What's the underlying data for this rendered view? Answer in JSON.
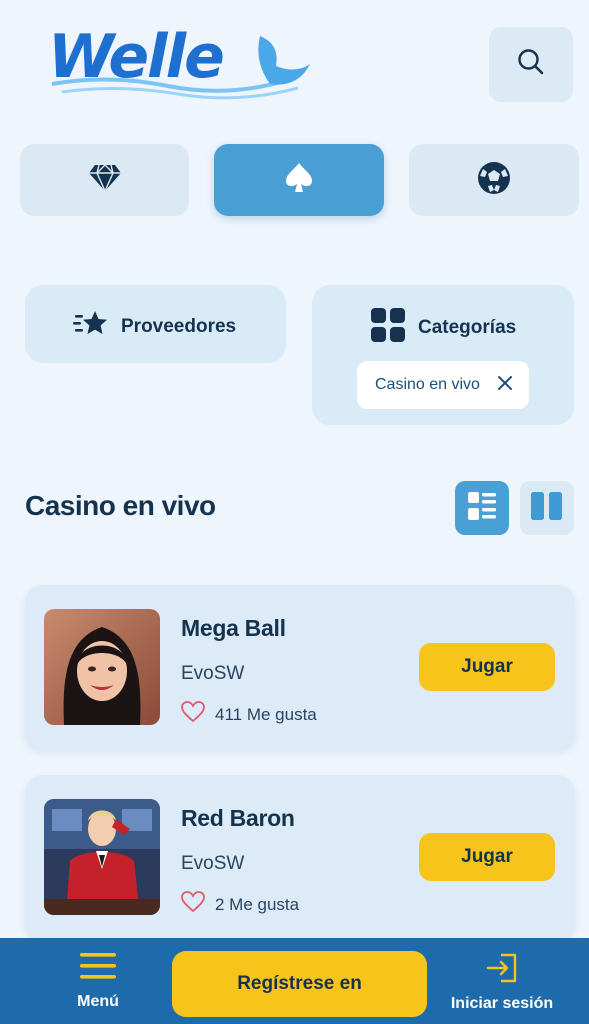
{
  "header": {
    "logo_text": "Welle",
    "search_icon": "search-icon"
  },
  "segments": [
    {
      "icon": "diamond-icon",
      "active": false
    },
    {
      "icon": "spade-icon",
      "active": true
    },
    {
      "icon": "soccer-ball-icon",
      "active": false
    }
  ],
  "filters": {
    "providers_label": "Proveedores",
    "categories_label": "Categorías",
    "active_chip": "Casino en vivo"
  },
  "section": {
    "title": "Casino en vivo"
  },
  "games": [
    {
      "name": "Mega Ball",
      "provider": "EvoSW",
      "likes": "411 Me gusta",
      "button": "Jugar"
    },
    {
      "name": "Red Baron",
      "provider": "EvoSW",
      "likes": "2 Me gusta",
      "button": "Jugar"
    }
  ],
  "bottom_nav": {
    "menu_label": "Menú",
    "register_label": "Regístrese en",
    "login_label": "Iniciar sesión"
  },
  "colors": {
    "background": "#eef5fc",
    "accent": "#4a9fd5",
    "button_yellow": "#f7c41c",
    "nav_blue": "#1e6bab",
    "text_dark": "#15324f"
  }
}
